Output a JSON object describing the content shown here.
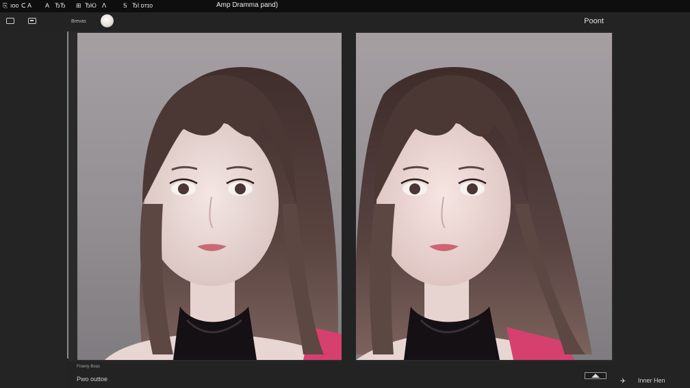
{
  "menubar": {
    "items": [
      "⎘",
      "ıoo",
      "ᑕ",
      "A",
      "ЂЂ",
      "⊞",
      "ЂЮ",
      "ᐱ",
      "Ꭶ",
      "ЂІ ᴅᴛɪᴏ"
    ],
    "title": "Amp Dramma pand)"
  },
  "toolbar": {
    "zoom_label": "Brevas",
    "panel_title": "Poont"
  },
  "bottom": {
    "small_label": "Froeny Boas",
    "label": "Pwo outtoe"
  },
  "right_panel": {
    "icon": "✈",
    "label": "Inner Hen"
  },
  "colors": {
    "background": "#202020",
    "menubar": "#0e0e0e",
    "photo_bg": "#9a9598",
    "hair": "#4a3734",
    "skin": "#eadbd8",
    "top_pink": "#d6406e"
  }
}
